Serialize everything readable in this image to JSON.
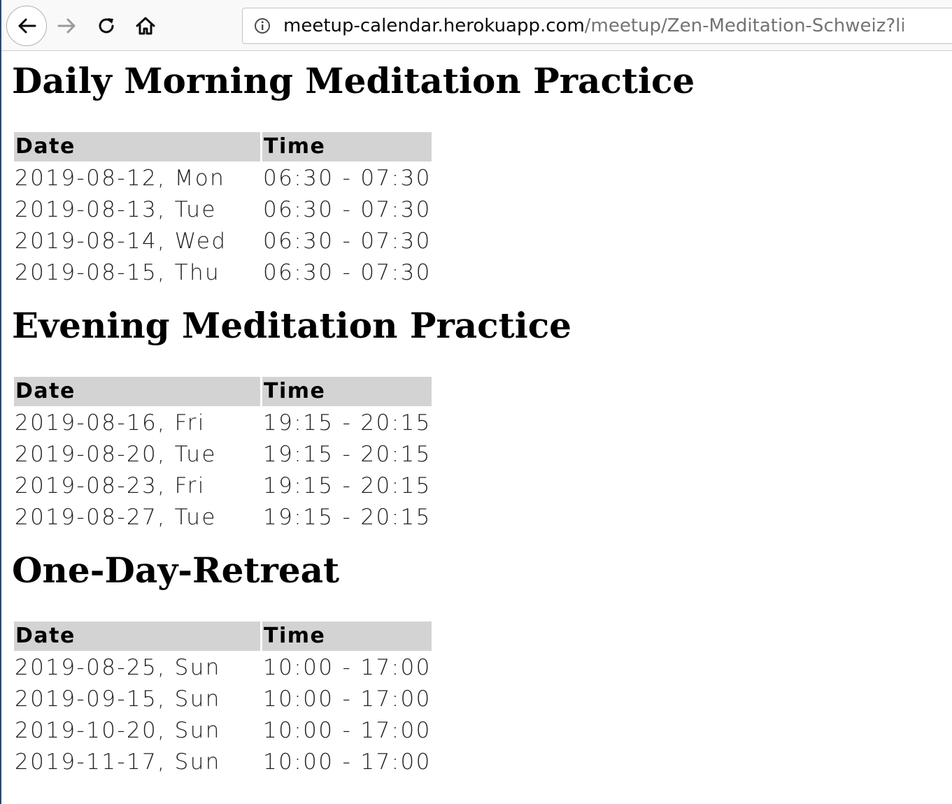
{
  "browser": {
    "url_host": "meetup-calendar.herokuapp.com",
    "url_path": "/meetup/Zen-Meditation-Schweiz?li"
  },
  "table_headers": {
    "date": "Date",
    "time": "Time"
  },
  "sections": [
    {
      "title": "Daily Morning Meditation Practice",
      "rows": [
        {
          "date": "2019-08-12, Mon",
          "time": "06:30 - 07:30"
        },
        {
          "date": "2019-08-13, Tue",
          "time": "06:30 - 07:30"
        },
        {
          "date": "2019-08-14, Wed",
          "time": "06:30 - 07:30"
        },
        {
          "date": "2019-08-15, Thu",
          "time": "06:30 - 07:30"
        }
      ]
    },
    {
      "title": "Evening Meditation Practice",
      "rows": [
        {
          "date": "2019-08-16, Fri",
          "time": "19:15 - 20:15"
        },
        {
          "date": "2019-08-20, Tue",
          "time": "19:15 - 20:15"
        },
        {
          "date": "2019-08-23, Fri",
          "time": "19:15 - 20:15"
        },
        {
          "date": "2019-08-27, Tue",
          "time": "19:15 - 20:15"
        }
      ]
    },
    {
      "title": "One-Day-Retreat",
      "rows": [
        {
          "date": "2019-08-25, Sun",
          "time": "10:00 - 17:00"
        },
        {
          "date": "2019-09-15, Sun",
          "time": "10:00 - 17:00"
        },
        {
          "date": "2019-10-20, Sun",
          "time": "10:00 - 17:00"
        },
        {
          "date": "2019-11-17, Sun",
          "time": "10:00 - 17:00"
        }
      ]
    }
  ]
}
